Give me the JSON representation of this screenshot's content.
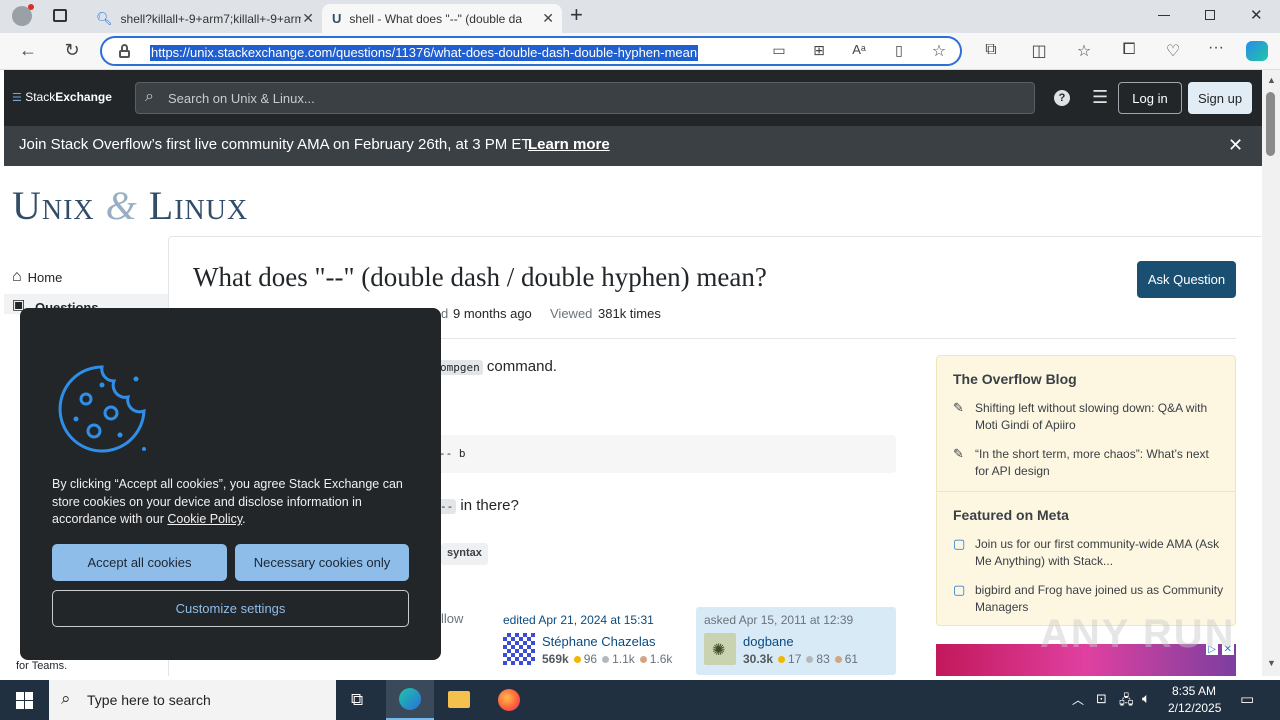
{
  "browser": {
    "tabs": [
      {
        "title": "shell?killall+-9+arm7;killall+-9+arm"
      },
      {
        "title": "shell - What does \"--\" (double da"
      }
    ],
    "url": "https://unix.stackexchange.com/questions/11376/what-does-double-dash-double-hyphen-mean",
    "new_tab": "+"
  },
  "se": {
    "logo_a": "Stack",
    "logo_b": "Exchange",
    "search_placeholder": "Search on Unix & Linux...",
    "login": "Log in",
    "signup": "Sign up"
  },
  "banner": {
    "text": "Join Stack Overflow’s first live community AMA on February 26th, at 3 PM ET.",
    "link": "Learn more"
  },
  "site": {
    "name_a": "Unix",
    "amp": "&",
    "name_b": "Linux"
  },
  "nav": {
    "home": "Home",
    "questions": "Questions",
    "teams_text": "for Teams."
  },
  "question": {
    "title": "What does \"--\" (double dash / double hyphen) mean?",
    "ask": "Ask Question",
    "meta_frag": "d",
    "modified_value": "9 months ago",
    "viewed_label": "Viewed",
    "viewed_value": "381k times",
    "body_code1": "ompgen",
    "body_text1": "command.",
    "code_block": "-- b",
    "body_code2": "--",
    "body_text2": "in there?",
    "tag": "syntax",
    "follow_frag": "llow"
  },
  "editor": {
    "label": "edited Apr 21, 2024 at 15:31",
    "name": "Stéphane Chazelas",
    "rep": "569k",
    "gold": "96",
    "silver": "1.1k",
    "bronze": "1.6k"
  },
  "asker": {
    "label": "asked Apr 15, 2011 at 12:39",
    "name": "dogbane",
    "rep": "30.3k",
    "gold": "17",
    "silver": "83",
    "bronze": "61"
  },
  "sidebar": {
    "blog_title": "The Overflow Blog",
    "blog_items": [
      "Shifting left without slowing down: Q&A with Moti Gindi of Apiiro",
      "“In the short term, more chaos”: What’s next for API design"
    ],
    "meta_title": "Featured on Meta",
    "meta_items": [
      "Join us for our first community-wide AMA (Ask Me Anything) with Stack...",
      "bigbird and Frog have joined us as Community Managers"
    ]
  },
  "cookie": {
    "text_before": "By clicking “Accept all cookies”, you agree Stack Exchange can store cookies on your device and disclose information in accordance with our",
    "policy_link": "Cookie Policy",
    "accept": "Accept all cookies",
    "necessary": "Necessary cookies only",
    "customize": "Customize settings"
  },
  "taskbar": {
    "search": "Type here to search",
    "time": "8:35 AM",
    "date": "2/12/2025"
  },
  "watermark": "ANY RUN",
  "colors": {
    "accent_blue": "#2b6fd8",
    "se_dark": "#232629",
    "ask_button": "#1b4f72",
    "cookie_button": "#8fbdea",
    "widget_bg": "#fdf7e2"
  }
}
